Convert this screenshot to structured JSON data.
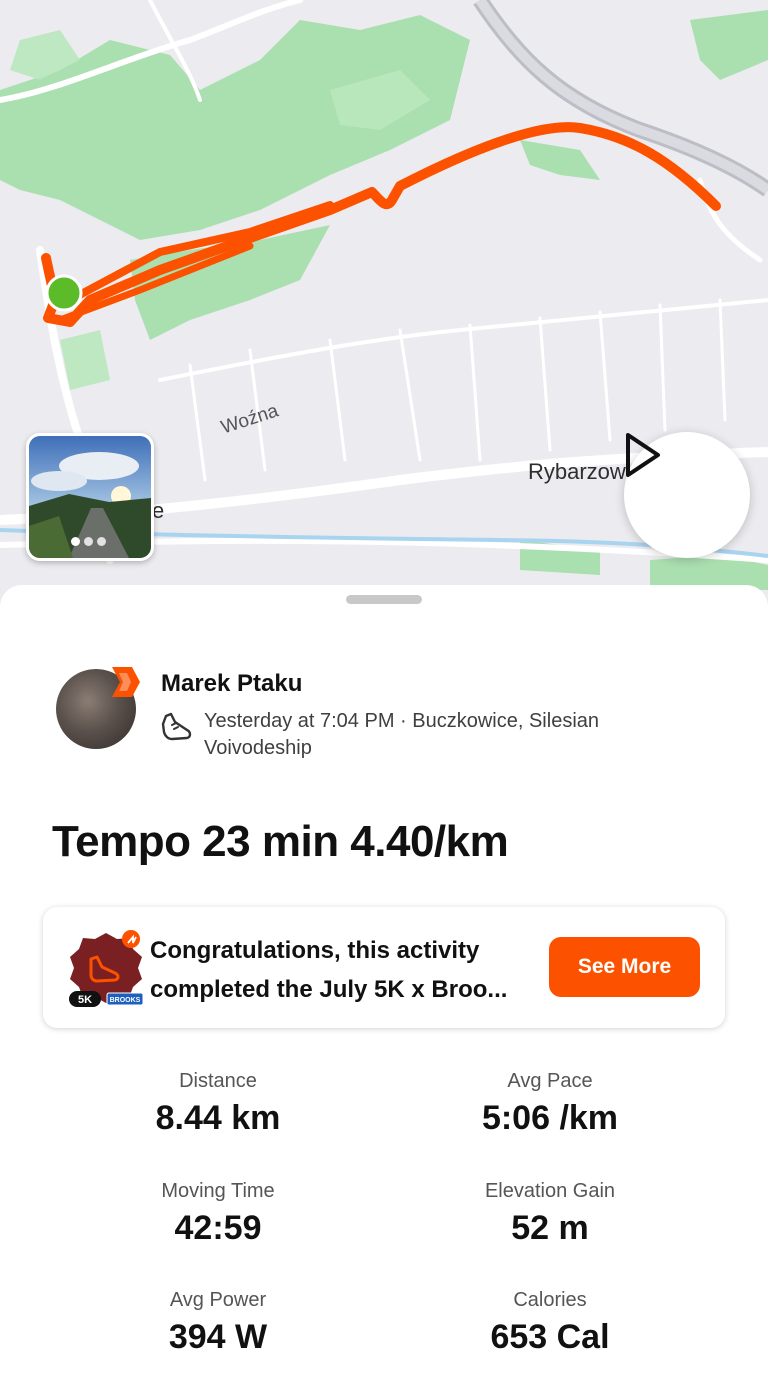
{
  "map": {
    "places": {
      "wozna": "Woźna",
      "rybarzowice": "Rybarzow",
      "edge": "e"
    },
    "route_color": "#fc5200",
    "start_color": "#5bbb29"
  },
  "photo": {
    "icon": "photo-thumbnail"
  },
  "play": {
    "icon": "play-icon"
  },
  "activity": {
    "athlete": "Marek Ptaku",
    "meta": "Yesterday at 7:04 PM · Buczkowice, Silesian Voivodeship",
    "title": "Tempo 23 min 4.40/km"
  },
  "challenge": {
    "text_line1": "Congratulations, this activity",
    "text_line2": "completed the July 5K x Broo...",
    "badge_5k": "5K",
    "badge_brand": "BROOKS",
    "button": "See More",
    "accent": "#fc5200"
  },
  "stats": [
    {
      "label": "Distance",
      "value": "8.44 km"
    },
    {
      "label": "Avg Pace",
      "value": "5:06 /km"
    },
    {
      "label": "Moving Time",
      "value": "42:59"
    },
    {
      "label": "Elevation Gain",
      "value": "52 m"
    },
    {
      "label": "Avg Power",
      "value": "394 W"
    },
    {
      "label": "Calories",
      "value": "653 Cal"
    }
  ]
}
